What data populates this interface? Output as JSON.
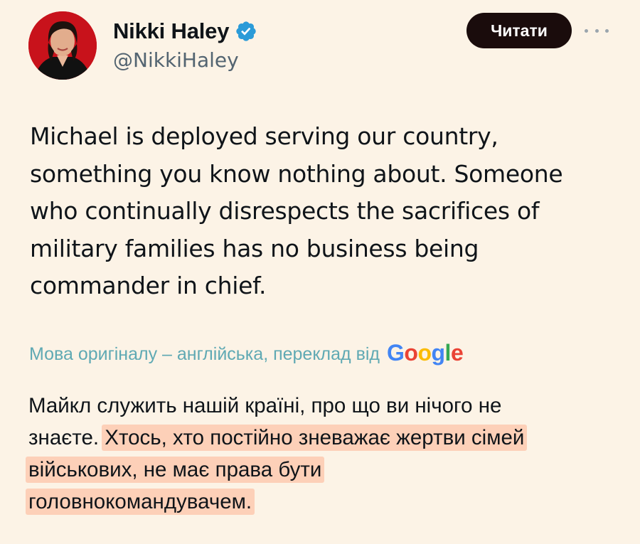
{
  "author": {
    "display_name": "Nikki Haley",
    "handle": "@NikkiHaley",
    "verified_icon": "verified-badge-icon",
    "avatar_icon": "profile-photo"
  },
  "actions": {
    "follow_label": "Читати",
    "more_icon": "more-options-icon"
  },
  "tweet": {
    "lines": [
      "Michael is deployed serving our country,",
      "something you know nothing about. Someone",
      "who continually disrespects the sacrifices of",
      "military families has no business being",
      "commander in chief."
    ]
  },
  "translation": {
    "note": "Мова оригіналу – англійська, переклад від",
    "provider": "Google",
    "line1": "Майкл служить нашій країні, про що ви нічого не",
    "line2_plain": "знаєте. ",
    "line2_highlight": "Хтось, хто постійно зневажає жертви сімей",
    "line3_highlight": "військових, не має права бути",
    "line4_highlight": "головнокомандувачем."
  },
  "colors": {
    "background": "#fcf3e6",
    "highlight": "#fdd0b8",
    "translation_note": "#5fa9b3",
    "verified": "#2b9bd8"
  }
}
